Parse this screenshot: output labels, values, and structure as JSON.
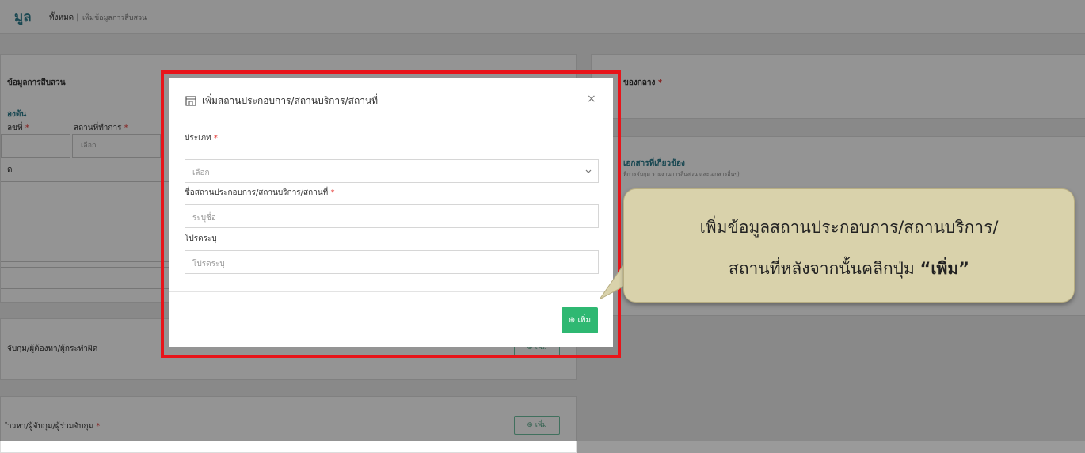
{
  "header": {
    "title": "มูล",
    "crumb_all": "ทั้งหมด |",
    "crumb_current": "เพิ่มข้อมูลการสืบสวน"
  },
  "background": {
    "section_info": "ข้อมูลการสืบสวน",
    "sub_heading": "องต้น",
    "field_no": "ลขที่",
    "field_place": "สถานที่ทำการ",
    "place_placeholder": "เลือก",
    "row_label": "ด",
    "section_arrest": "จับกุม/ผู้ต้องหา/ผู้กระทำผิด",
    "section_accused": "ำวหา/ผู้จับกุม/ผู้ร่วมจับกุม",
    "add_label": "⊕ เพิ่ม",
    "right_title": "ของกลาง",
    "right_docs_title": "เอกสารที่เกี่ยวข้อง",
    "right_docs_sub": "ที่การจับกุม รายงานการสืบสวน และเอกสารอื่นๆ)"
  },
  "modal": {
    "title": "เพิ่มสถานประกอบการ/สถานบริการ/สถานที่",
    "close_glyph": "×",
    "type_label": "ประเภท",
    "type_placeholder": "เลือก",
    "name_label": "ชื่อสถานประกอบการ/สถานบริการ/สถานที่",
    "name_placeholder": "ระบุชื่อ",
    "detail_label": "โปรดระบุ",
    "detail_placeholder": "โปรดระบุ",
    "required_mark": "*",
    "add_button": "⊕ เพิ่ม"
  },
  "callout": {
    "line1": "เพิ่มข้อมูลสถานประกอบการ/สถานบริการ/",
    "line2_pre": "สถานที่หลังจากนั้นคลิกปุ่ม ",
    "line2_bold": "“เพิ่ม”"
  },
  "colors": {
    "highlight": "#e8141a",
    "add_button": "#2fb872",
    "callout_bg": "#d9d2ab",
    "required": "#e53935"
  }
}
